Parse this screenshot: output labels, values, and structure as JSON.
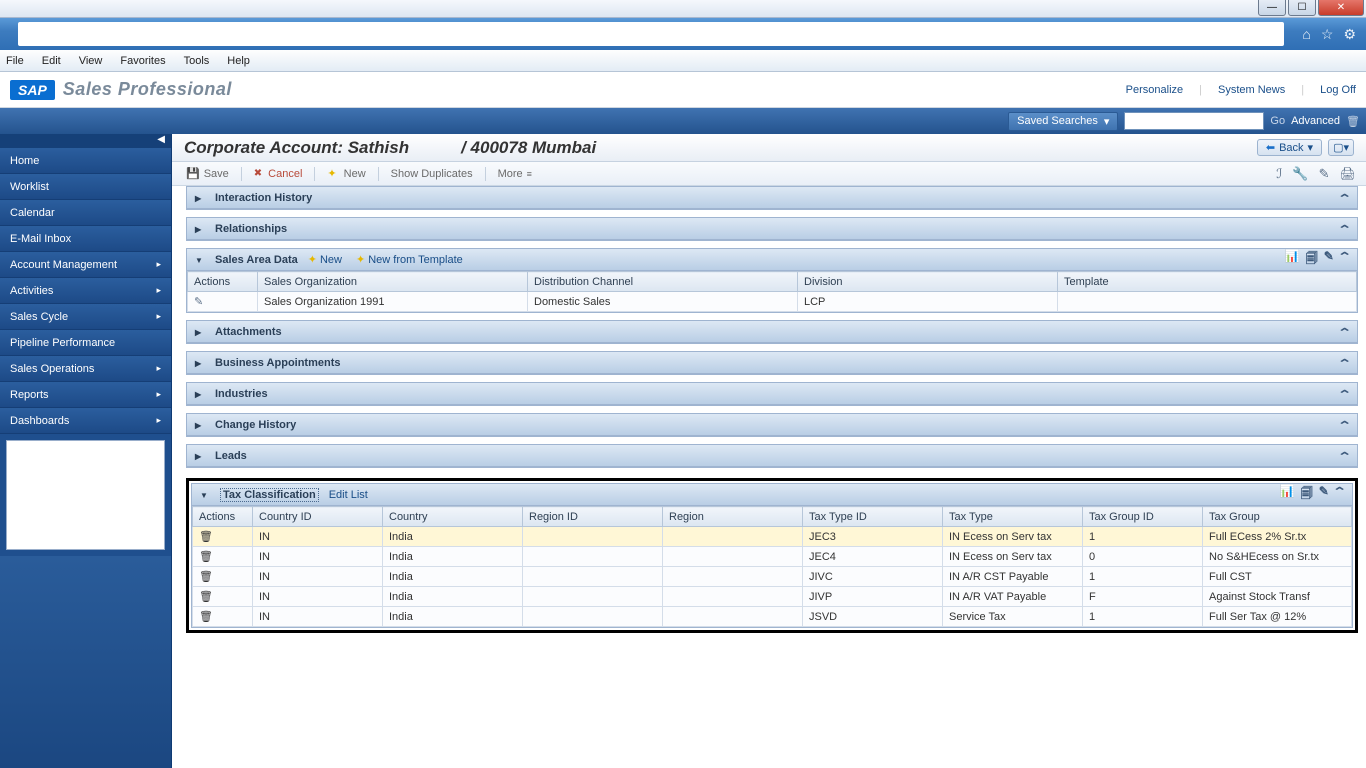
{
  "menubar": {
    "file": "File",
    "edit": "Edit",
    "view": "View",
    "favorites": "Favorites",
    "tools": "Tools",
    "help": "Help"
  },
  "sap": {
    "brand": "SAP",
    "product": "Sales Professional",
    "links": {
      "personalize": "Personalize",
      "system_news": "System News",
      "log_off": "Log Off"
    }
  },
  "search": {
    "saved": "Saved Searches",
    "go": "Go",
    "advanced": "Advanced"
  },
  "nav": {
    "items": [
      {
        "label": "Home",
        "sub": false
      },
      {
        "label": "Worklist",
        "sub": false
      },
      {
        "label": "Calendar",
        "sub": false
      },
      {
        "label": "E-Mail Inbox",
        "sub": false
      },
      {
        "label": "Account Management",
        "sub": true
      },
      {
        "label": "Activities",
        "sub": true
      },
      {
        "label": "Sales Cycle",
        "sub": true
      },
      {
        "label": "Pipeline Performance",
        "sub": false
      },
      {
        "label": "Sales Operations",
        "sub": true
      },
      {
        "label": "Reports",
        "sub": true
      },
      {
        "label": "Dashboards",
        "sub": true
      }
    ]
  },
  "page": {
    "title_a": "Corporate Account: Sathish",
    "title_b": "/ 400078 Mumbai",
    "back": "Back"
  },
  "toolbar": {
    "save": "Save",
    "cancel": "Cancel",
    "new": "New",
    "show_dup": "Show Duplicates",
    "more": "More"
  },
  "panels": {
    "interaction_history": "Interaction History",
    "relationships": "Relationships",
    "sales_area": {
      "title": "Sales Area Data",
      "new": "New",
      "new_tpl": "New from Template",
      "cols": {
        "actions": "Actions",
        "org": "Sales Organization",
        "dist": "Distribution Channel",
        "div": "Division",
        "tpl": "Template"
      },
      "row": {
        "org": "Sales Organization 1991",
        "dist": "Domestic Sales",
        "div": "LCP",
        "tpl": ""
      }
    },
    "attachments": "Attachments",
    "biz_appt": "Business Appointments",
    "industries": "Industries",
    "change_hist": "Change History",
    "leads": "Leads",
    "tax": {
      "title": "Tax Classification",
      "edit_list": "Edit List",
      "cols": {
        "actions": "Actions",
        "country_id": "Country ID",
        "country": "Country",
        "region_id": "Region ID",
        "region": "Region",
        "tax_type_id": "Tax Type ID",
        "tax_type": "Tax Type",
        "tax_group_id": "Tax Group ID",
        "tax_group": "Tax Group"
      },
      "rows": [
        {
          "country_id": "IN",
          "country": "India",
          "region_id": "",
          "region": "",
          "tax_type_id": "JEC3",
          "tax_type": "IN Ecess on Serv tax",
          "tax_group_id": "1",
          "tax_group": "Full ECess 2% Sr.tx"
        },
        {
          "country_id": "IN",
          "country": "India",
          "region_id": "",
          "region": "",
          "tax_type_id": "JEC4",
          "tax_type": "IN Ecess on Serv tax",
          "tax_group_id": "0",
          "tax_group": "No S&HEcess on Sr.tx"
        },
        {
          "country_id": "IN",
          "country": "India",
          "region_id": "",
          "region": "",
          "tax_type_id": "JIVC",
          "tax_type": "IN A/R CST Payable",
          "tax_group_id": "1",
          "tax_group": "Full CST"
        },
        {
          "country_id": "IN",
          "country": "India",
          "region_id": "",
          "region": "",
          "tax_type_id": "JIVP",
          "tax_type": "IN A/R VAT Payable",
          "tax_group_id": "F",
          "tax_group": "Against Stock Transf"
        },
        {
          "country_id": "IN",
          "country": "India",
          "region_id": "",
          "region": "",
          "tax_type_id": "JSVD",
          "tax_type": "Service Tax",
          "tax_group_id": "1",
          "tax_group": "Full Ser Tax @ 12%"
        }
      ]
    }
  }
}
